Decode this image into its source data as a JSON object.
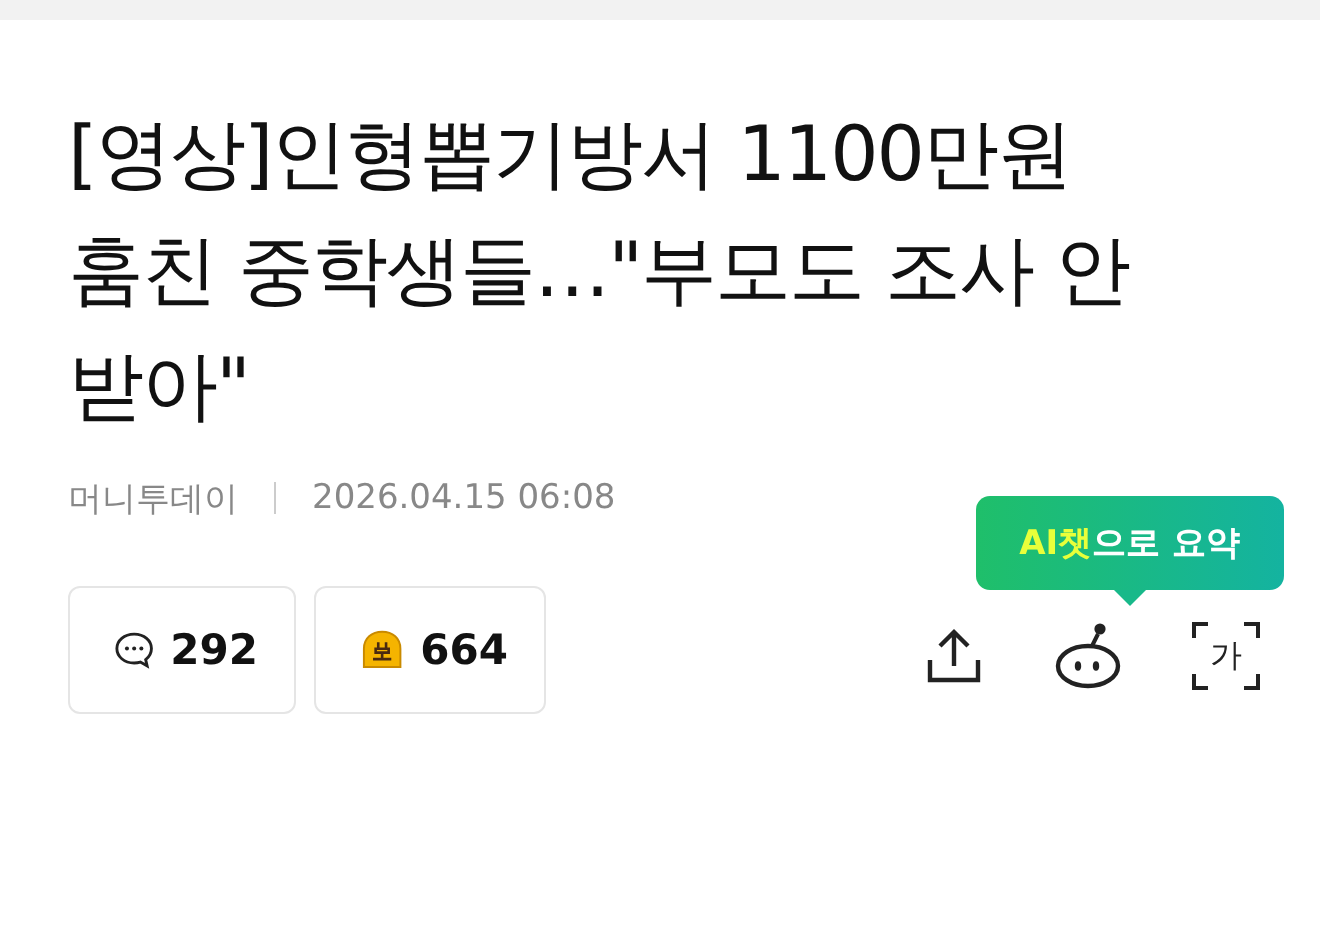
{
  "headline": [
    "[영상]인형뽑기방서 1100만원",
    "훔친 중학생들…\"부모도 조사 안",
    "받아\""
  ],
  "meta": {
    "source": "머니투데이",
    "datetime": "2026.04.15 06:08"
  },
  "reactions": [
    {
      "kind": "comment",
      "count": "292"
    },
    {
      "kind": "emotion",
      "count": "664"
    }
  ],
  "tooltip": {
    "highlight": "AI챗",
    "rest": "으로 요약"
  },
  "font_size_icon": "가"
}
